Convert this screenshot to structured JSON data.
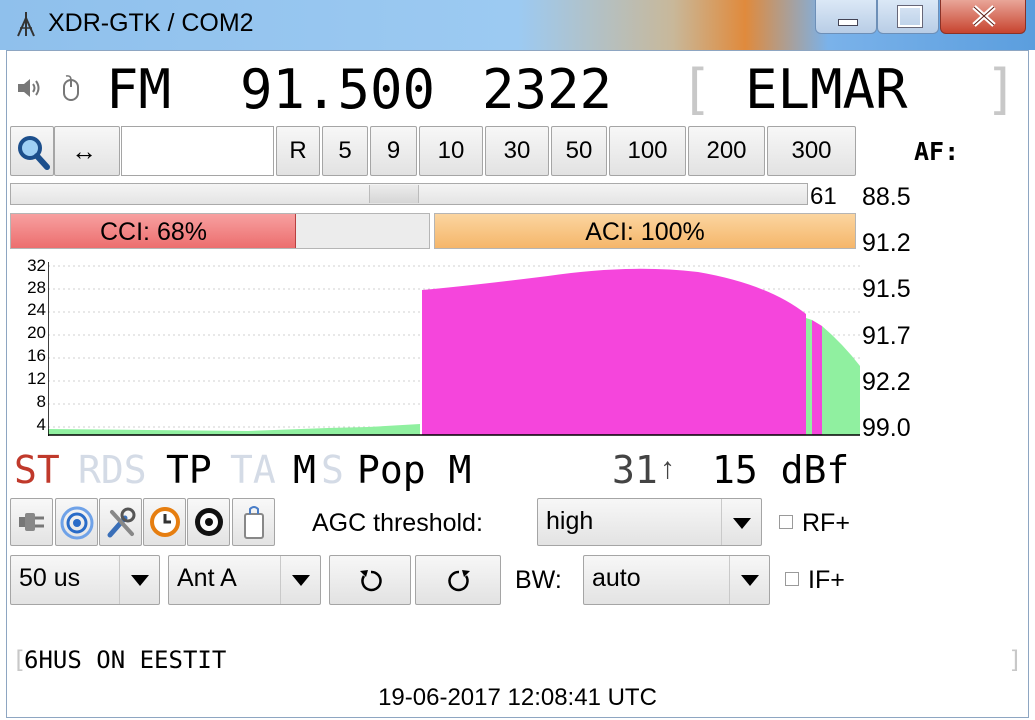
{
  "window": {
    "title": "XDR-GTK / COM2"
  },
  "header": {
    "band": "FM",
    "frequency": "91.500",
    "pi": "2322",
    "bracket_left": "[",
    "ps": "ELMAR",
    "bracket_right": "]"
  },
  "toolbar": {
    "buttons": [
      "R",
      "5",
      "9",
      "10",
      "30",
      "50",
      "100",
      "200",
      "300"
    ],
    "input_value": "",
    "af_label": "AF:"
  },
  "signal": {
    "bar_value": "61"
  },
  "interference": {
    "cci_label": "CCI: 68%",
    "cci_fill": 0.68,
    "aci_label": "ACI: 100%",
    "aci_fill": 1.0
  },
  "af_list": [
    "88.5",
    "91.2",
    "91.5",
    "91.7",
    "92.2",
    "99.0"
  ],
  "graph": {
    "y_ticks": [
      "32",
      "28",
      "24",
      "20",
      "16",
      "12",
      "8",
      "4"
    ]
  },
  "rds": {
    "st": "ST",
    "rds": "RDS",
    "tp": "TP",
    "ta": "TA",
    "m": "M",
    "s": "S",
    "pty": "Pop M",
    "sig_value": "31",
    "sig_arrow": "↑",
    "level": "15 dBf"
  },
  "controls": {
    "agc_label": "AGC threshold:",
    "agc_value": "high",
    "rf_label": "RF+",
    "deemphasis_value": "50 us",
    "antenna_value": "Ant A",
    "bw_label": "BW:",
    "bw_value": "auto",
    "if_label": "IF+"
  },
  "radiotext": {
    "left_bracket": "[",
    "text": "6HUS ON EESTIT",
    "right_bracket": "]"
  },
  "status": {
    "time": "19-06-2017 12:08:41 UTC"
  },
  "colors": {
    "accent_red": "#c0392b",
    "spectrum_magenta": "#f545dc",
    "spectrum_green": "#90f0a0",
    "cci_fill": "#f28c8c",
    "aci_fill": "#f8c17a"
  }
}
